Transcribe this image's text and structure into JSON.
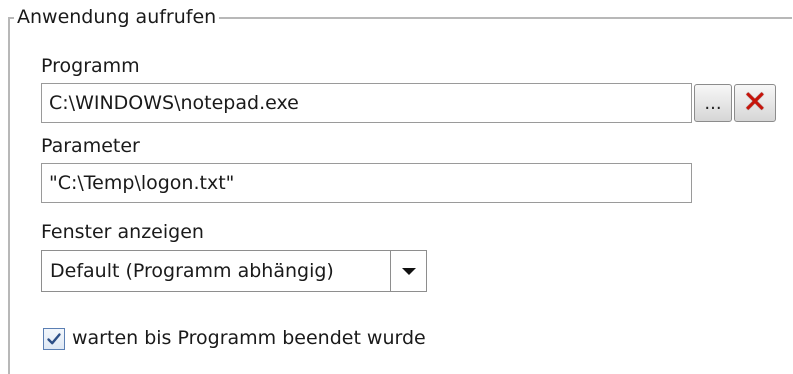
{
  "group": {
    "title": "Anwendung aufrufen"
  },
  "program": {
    "label": "Programm",
    "value": "C:\\WINDOWS\\notepad.exe",
    "browse_label": "...",
    "clear_icon": "red-x-icon"
  },
  "parameter": {
    "label": "Parameter",
    "value": "\"C:\\Temp\\logon.txt\""
  },
  "window": {
    "label": "Fenster anzeigen",
    "selected": "Default (Programm abhängig)"
  },
  "wait": {
    "label": "warten bis Programm beendet wurde",
    "checked": true
  },
  "colors": {
    "clear_icon": "#c8140a",
    "checkbox_border": "#5b7fb3",
    "frame": "#b8b8b8"
  }
}
